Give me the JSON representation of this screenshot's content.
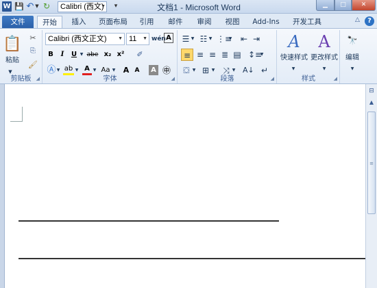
{
  "qat": {
    "word_icon": "W",
    "font_box": "Calibri (西文)",
    "save_icon": "save-icon",
    "undo_icon": "undo-icon",
    "redo_icon": "redo-icon"
  },
  "window": {
    "title": "文档1 - Microsoft Word"
  },
  "tabs": [
    {
      "label": "文件"
    },
    {
      "label": "开始"
    },
    {
      "label": "插入"
    },
    {
      "label": "页面布局"
    },
    {
      "label": "引用"
    },
    {
      "label": "邮件"
    },
    {
      "label": "审阅"
    },
    {
      "label": "视图"
    },
    {
      "label": "Add-Ins"
    },
    {
      "label": "开发工具"
    }
  ],
  "ribbon": {
    "clipboard": {
      "label": "剪贴板",
      "paste": "粘贴"
    },
    "font": {
      "label": "字体",
      "font_name": "Calibri (西文正文)",
      "font_size": "11",
      "bold": "B",
      "italic": "I",
      "underline": "U",
      "strike": "abe",
      "subscript": "x₂",
      "superscript": "x²",
      "change_case": "Aa",
      "grow": "A",
      "shrink": "A",
      "char_border": "A",
      "enclose": "㊥",
      "wen": "wén",
      "bigA": "A"
    },
    "paragraph": {
      "label": "段落"
    },
    "styles": {
      "label": "样式",
      "quick_styles": "快速样式",
      "change_styles": "更改样式"
    },
    "editing": {
      "label": "编辑"
    }
  },
  "colors": {
    "file_tab": "#2a5fa8",
    "highlight": "#ffef00",
    "font_color": "#e02020",
    "align_active": "#ffd86b"
  }
}
